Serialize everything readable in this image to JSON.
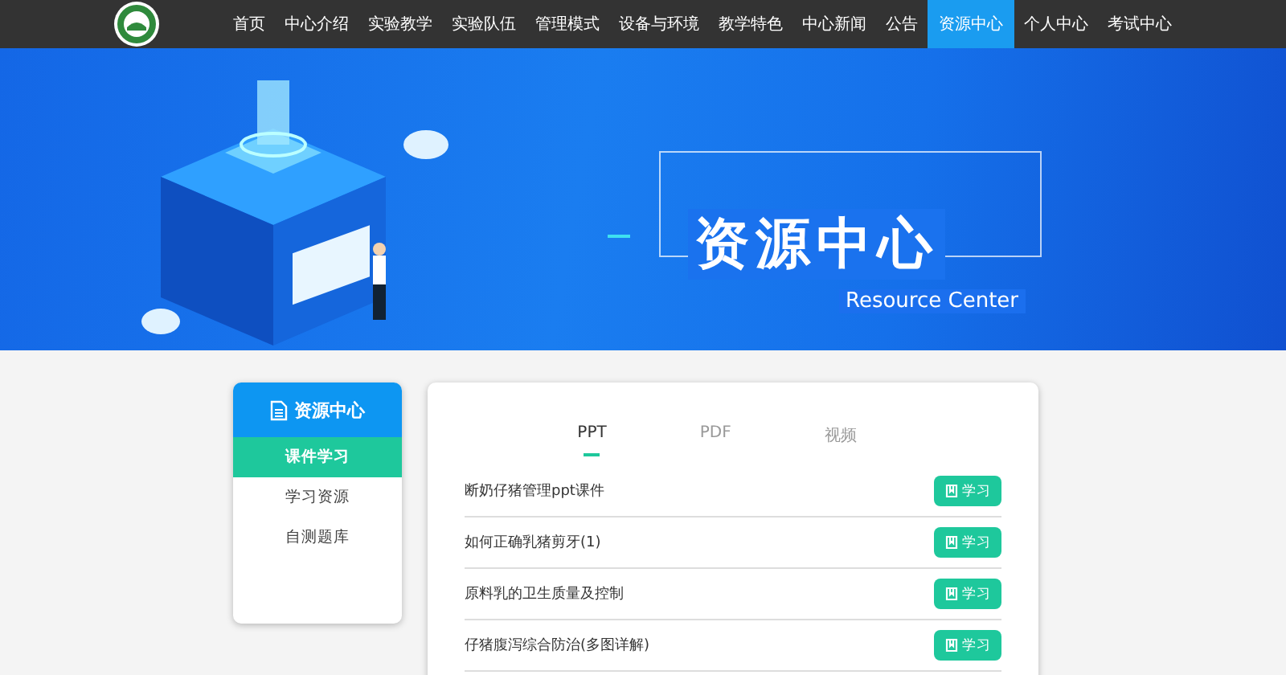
{
  "nav": {
    "items": [
      {
        "label": "首页",
        "selected": false
      },
      {
        "label": "中心介绍",
        "selected": false
      },
      {
        "label": "实验教学",
        "selected": false
      },
      {
        "label": "实验队伍",
        "selected": false
      },
      {
        "label": "管理模式",
        "selected": false
      },
      {
        "label": "设备与环境",
        "selected": false
      },
      {
        "label": "教学特色",
        "selected": false
      },
      {
        "label": "中心新闻",
        "selected": false
      },
      {
        "label": "公告",
        "selected": false
      },
      {
        "label": "资源中心",
        "selected": true
      },
      {
        "label": "个人中心",
        "selected": false
      },
      {
        "label": "考试中心",
        "selected": false
      }
    ]
  },
  "banner": {
    "title": "资源中心",
    "subtitle": "Resource Center"
  },
  "sidebar": {
    "title": "资源中心",
    "items": [
      {
        "label": "课件学习",
        "selected": true
      },
      {
        "label": "学习资源",
        "selected": false
      },
      {
        "label": "自测题库",
        "selected": false
      }
    ]
  },
  "tabs": [
    {
      "label": "PPT",
      "selected": true
    },
    {
      "label": "PDF",
      "selected": false
    },
    {
      "label": "视频",
      "selected": false
    }
  ],
  "resources": [
    {
      "title": "断奶仔猪管理ppt课件",
      "button": "学习"
    },
    {
      "title": "如何正确乳猪剪牙(1)",
      "button": "学习"
    },
    {
      "title": "原料乳的卫生质量及控制",
      "button": "学习"
    },
    {
      "title": "仔猪腹泻综合防治(多图详解)",
      "button": "学习"
    }
  ]
}
